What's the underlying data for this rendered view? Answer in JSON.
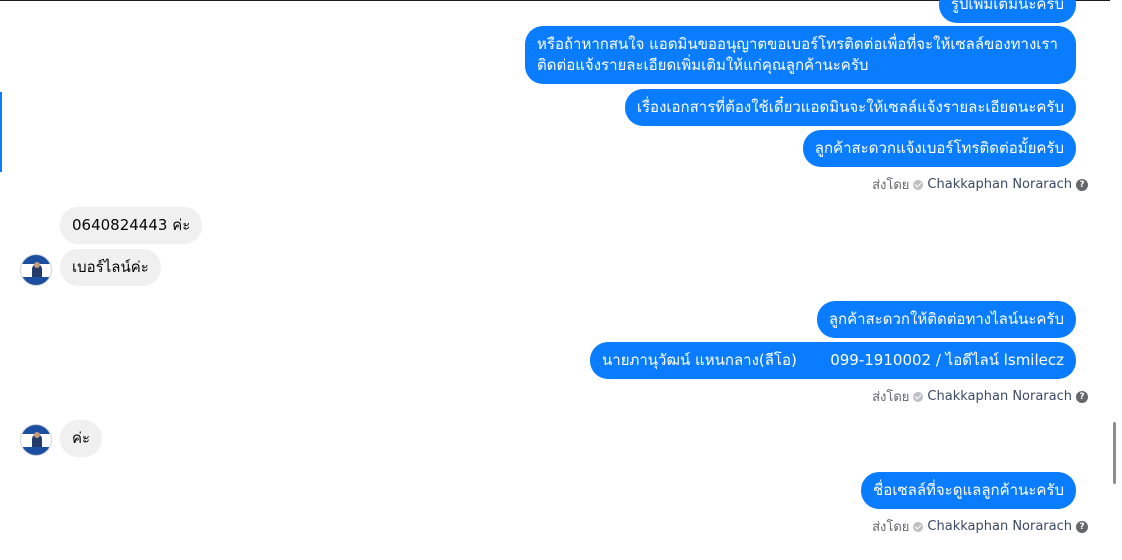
{
  "messages": {
    "out1": "รูปเพิ่มเติมนะครับ",
    "out2": "หรือถ้าหากสนใจ แอดมินขออนุญาตขอเบอร์โทรติดต่อเพื่อที่จะให้เซลล์ของทางเราติดต่อแจ้งรายละเอียดเพิ่มเติมให้แก่คุณลูกค้านะครับ",
    "out3": "เรื่องเอกสารที่ต้องใช้เดี๋ยวแอดมินจะให้เซลล์แจ้งรายละเอียดนะครับ",
    "out4": "ลูกค้าสะดวกแจ้งเบอร์โทรติดต่อมั้ยครับ",
    "in1": "0640824443 ค่ะ",
    "in2": "เบอร์ไลน์ค่ะ",
    "out5": "ลูกค้าสะดวกให้ติดต่อทางไลน์นะครับ",
    "out6": "นายภานุวัฒน์ แหนกลาง(ลีโอ)       099-1910002 / ไอดีไลน์ lsmilecz",
    "in3": "ค่ะ",
    "out7": "ชื่อเซลล์ที่จะดูแลลูกค้านะครับ"
  },
  "sent_by": {
    "label": "ส่งโดย",
    "name": "Chakkaphan Norarach",
    "help": "?"
  },
  "colors": {
    "outgoing_bubble": "#0a7cff",
    "incoming_bubble": "#f0f0f0"
  }
}
